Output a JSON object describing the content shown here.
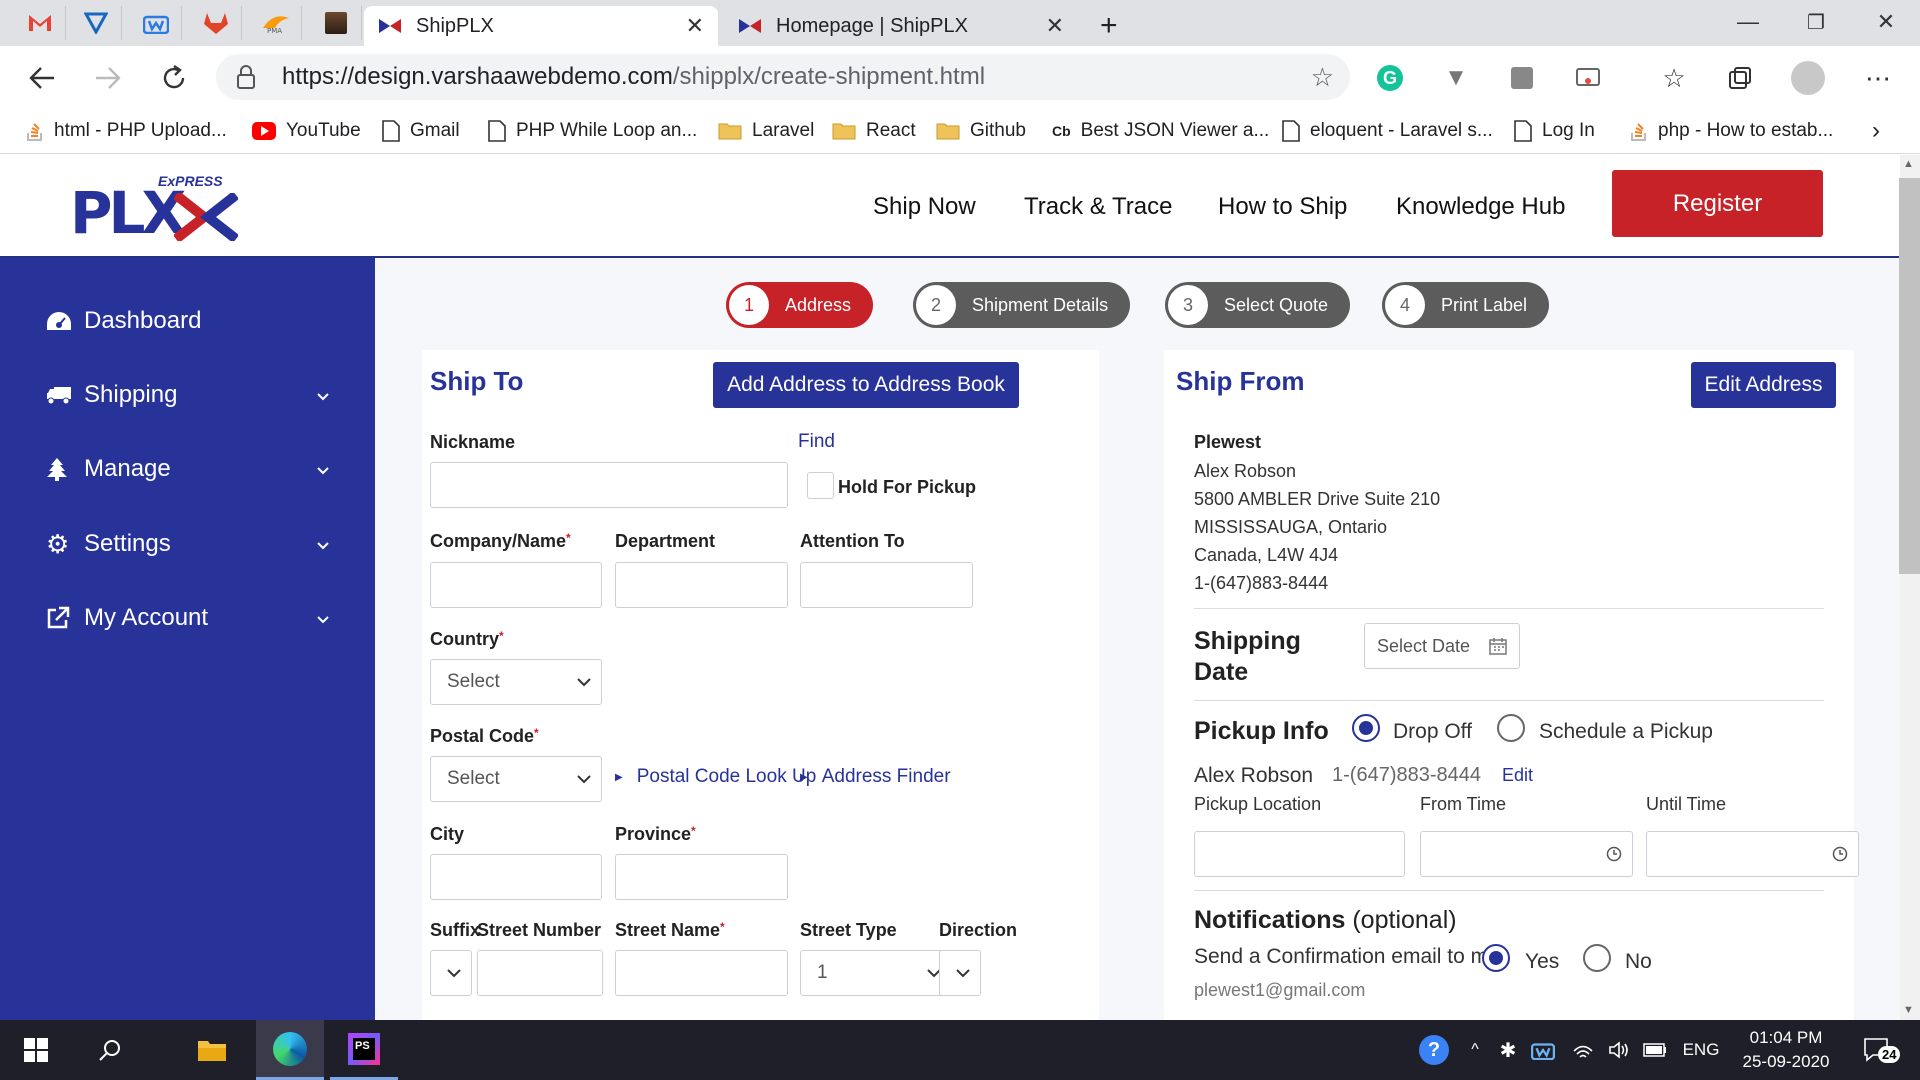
{
  "browser": {
    "tabs": [
      {
        "title": "ShipPLX",
        "active": true
      },
      {
        "title": "Homepage | ShipPLX",
        "active": false
      }
    ],
    "url_host": "https://design.varshaawebdemo.com",
    "url_path": "/shipplx/create-shipment.html",
    "bookmarks": [
      {
        "label": "html - PHP Upload...",
        "icon": "stackoverflow-icon"
      },
      {
        "label": "YouTube",
        "icon": "youtube-icon"
      },
      {
        "label": "Gmail",
        "icon": "page-icon"
      },
      {
        "label": "PHP While Loop an...",
        "icon": "page-icon"
      },
      {
        "label": "Laravel",
        "icon": "folder-icon"
      },
      {
        "label": "React",
        "icon": "folder-icon"
      },
      {
        "label": "Github",
        "icon": "folder-icon"
      },
      {
        "label": "Best JSON Viewer a...",
        "icon": "cb-icon"
      },
      {
        "label": "eloquent - Laravel s...",
        "icon": "page-icon"
      },
      {
        "label": "Log In",
        "icon": "page-icon"
      },
      {
        "label": "php - How to estab...",
        "icon": "stackoverflow-icon"
      }
    ]
  },
  "site": {
    "logo_word": "PLX",
    "logo_express": "ExPRESS",
    "nav": [
      "Ship Now",
      "Track & Trace",
      "How to Ship",
      "Knowledge Hub"
    ],
    "register": "Register",
    "brand_red": "#c62228",
    "brand_blue": "#28339a"
  },
  "sidebar": [
    {
      "label": "Dashboard",
      "icon": "dashboard-icon",
      "expandable": false
    },
    {
      "label": "Shipping",
      "icon": "truck-icon",
      "expandable": true
    },
    {
      "label": "Manage",
      "icon": "tree-icon",
      "expandable": true
    },
    {
      "label": "Settings",
      "icon": "gear-icon",
      "expandable": true
    },
    {
      "label": "My Account",
      "icon": "external-link-icon",
      "expandable": true
    }
  ],
  "steps": [
    {
      "num": "1",
      "label": "Address",
      "active": true
    },
    {
      "num": "2",
      "label": "Shipment Details",
      "active": false
    },
    {
      "num": "3",
      "label": "Select Quote",
      "active": false
    },
    {
      "num": "4",
      "label": "Print Label",
      "active": false
    }
  ],
  "ship_to": {
    "title": "Ship To",
    "add_button": "Add Address to Address Book",
    "nickname": "Nickname",
    "find": "Find",
    "hold_pickup": "Hold For Pickup",
    "company": "Company/Name",
    "department": "Department",
    "attention": "Attention To",
    "country": "Country",
    "country_value": "Select",
    "postal": "Postal Code",
    "postal_value": "Select",
    "postal_lookup": "Postal Code Look Up",
    "address_finder": "Address Finder",
    "city": "City",
    "province": "Province",
    "suffix": "Suffix",
    "street_number": "Street Number",
    "street_name": "Street Name",
    "street_type": "Street Type",
    "street_type_value": "1",
    "direction": "Direction",
    "required_mark": "*"
  },
  "ship_from": {
    "title": "Ship From",
    "edit_button": "Edit Address",
    "company": "Plewest",
    "name": "Alex Robson",
    "street": "5800 AMBLER Drive Suite 210",
    "city": "MISSISSAUGA, Ontario",
    "country": "Canada, L4W 4J4",
    "phone": "1-(647)883-8444",
    "shipping_date_label": "Shipping Date",
    "select_date": "Select Date",
    "pickup_info": "Pickup Info",
    "drop_off": "Drop Off",
    "schedule_pickup": "Schedule a Pickup",
    "pickup_option": "Drop Off",
    "contact_name": "Alex Robson",
    "contact_phone": "1-(647)883-8444",
    "edit": "Edit",
    "pickup_location": "Pickup Location",
    "from_time": "From Time",
    "until_time": "Until Time",
    "notifications": "Notifications",
    "optional": "(optional)",
    "confirm_email": "Send a Confirmation email to me",
    "yes": "Yes",
    "no": "No",
    "confirm_value": "Yes",
    "email": "plewest1@gmail.com"
  },
  "taskbar": {
    "time": "01:04 PM",
    "date": "25-09-2020",
    "lang": "ENG",
    "notifications": "24"
  }
}
